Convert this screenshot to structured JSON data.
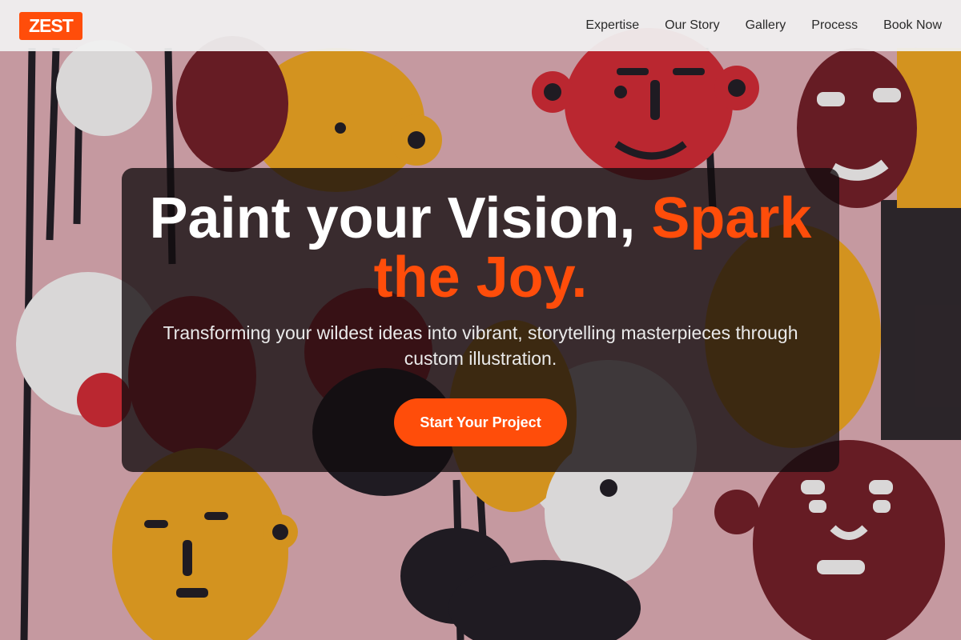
{
  "header": {
    "logo_text": "ZEST",
    "nav": [
      {
        "label": "Expertise"
      },
      {
        "label": "Our Story"
      },
      {
        "label": "Gallery"
      },
      {
        "label": "Process"
      },
      {
        "label": "Book Now"
      }
    ]
  },
  "hero": {
    "title_main": "Paint your Vision, ",
    "title_accent": "Spark the Joy.",
    "subtitle": "Transforming your wildest ideas into vibrant, storytelling masterpieces through custom illustration.",
    "cta_label": "Start Your Project"
  },
  "colors": {
    "accent": "#ff4d0a",
    "header_bg": "#f0f0f0",
    "card_bg": "#120c0e"
  }
}
